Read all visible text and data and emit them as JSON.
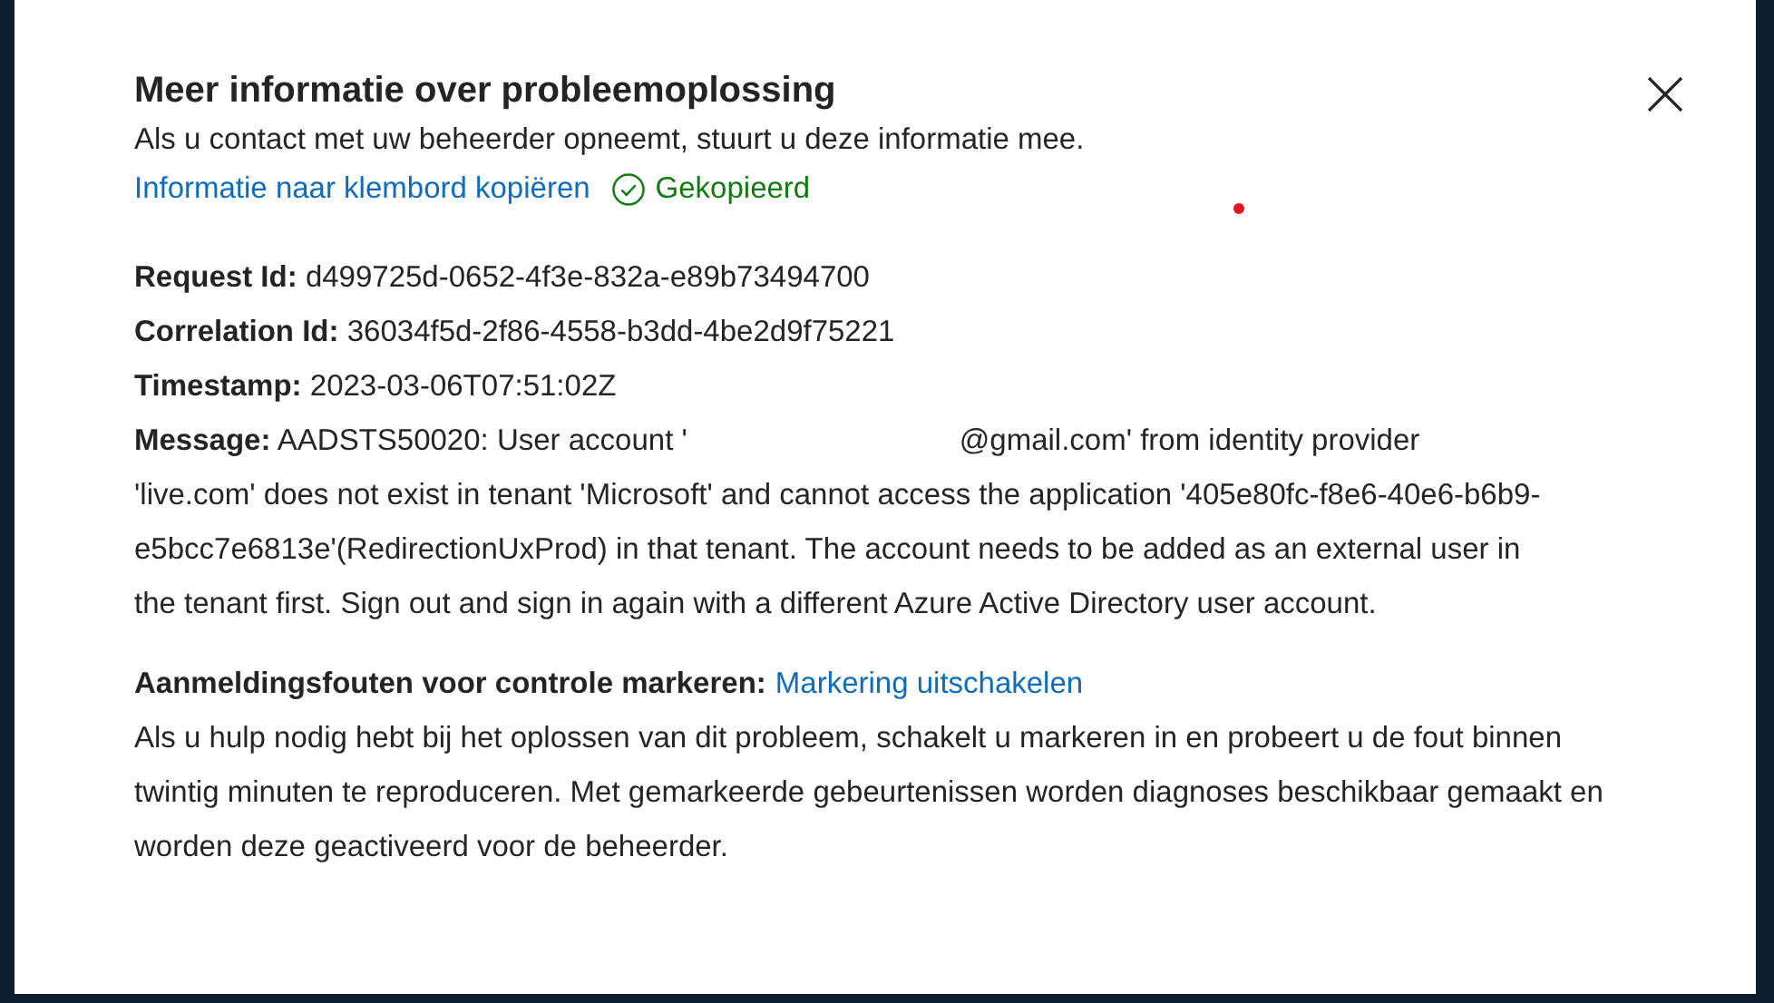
{
  "dialog": {
    "title": "Meer informatie over probleemoplossing",
    "subtitle": "Als u contact met uw beheerder opneemt, stuurt u deze informatie mee.",
    "copy_link": "Informatie naar klembord kopiëren",
    "copied_status": "Gekopieerd",
    "details": [
      {
        "label": "Request Id:",
        "value": "d499725d-0652-4f3e-832a-e89b73494700"
      },
      {
        "label": "Correlation Id:",
        "value": "36034f5d-2f86-4558-b3dd-4be2d9f75221"
      },
      {
        "label": "Timestamp:",
        "value": "2023-03-06T07:51:02Z"
      }
    ],
    "message": {
      "label": "Message:",
      "before_redaction": "AADSTS50020: User account '",
      "after_redaction": "@gmail.com' from identity provider 'live.com' does not exist in tenant 'Microsoft' and cannot access the application '405e80fc-f8e6-40e6-b6b9-e5bcc7e6813e'(RedirectionUxProd) in that tenant. The account needs to be added as an external user in the tenant first. Sign out and sign in again with a different Azure Active Directory user account."
    },
    "flagging": {
      "label": "Aanmeldingsfouten voor controle markeren:",
      "link": "Markering uitschakelen",
      "description": "Als u hulp nodig hebt bij het oplossen van dit probleem, schakelt u markeren in en probeert u de fout binnen twintig minuten te reproduceren. Met gemarkeerde gebeurtenissen worden diagnoses beschikbaar gemaakt en worden deze geactiveerd voor de beheerder."
    }
  }
}
